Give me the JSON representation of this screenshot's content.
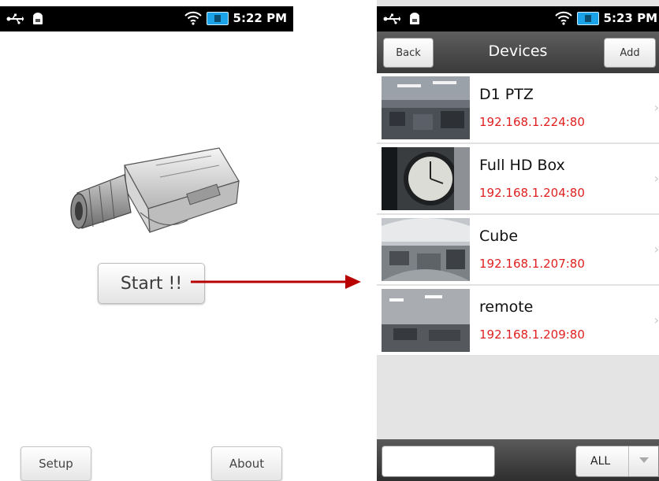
{
  "left_screen": {
    "status_time": "5:22 PM",
    "start_label": "Start !!",
    "setup_label": "Setup",
    "about_label": "About"
  },
  "right_screen": {
    "status_time": "5:23 PM",
    "title": "Devices",
    "back_label": "Back",
    "add_label": "Add",
    "devices": [
      {
        "name": "D1 PTZ",
        "address": "192.168.1.224:80"
      },
      {
        "name": "Full HD Box",
        "address": "192.168.1.204:80"
      },
      {
        "name": "Cube",
        "address": "192.168.1.207:80"
      },
      {
        "name": "remote",
        "address": "192.168.1.209:80"
      }
    ],
    "filter_select": "ALL"
  },
  "colors": {
    "address_red": "#e02020",
    "arrow_red": "#b80000",
    "navbar": "#4a4a4a",
    "statusbar": "#000000"
  },
  "icons": [
    "usb-icon",
    "android-debug-icon",
    "wifi-icon",
    "battery-icon",
    "chevron-right-icon",
    "dropdown-arrow-icon"
  ]
}
